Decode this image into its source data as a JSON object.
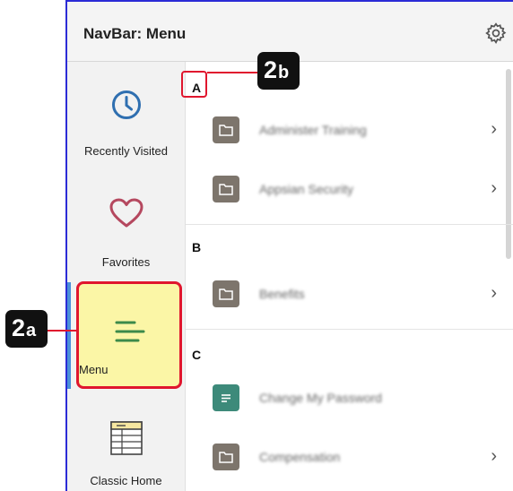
{
  "header": {
    "title": "NavBar: Menu",
    "settings_icon": "gear-icon"
  },
  "sidebar": {
    "items": [
      {
        "label": "Recently Visited",
        "icon": "clock-icon"
      },
      {
        "label": "Favorites",
        "icon": "heart-icon"
      },
      {
        "label": "Menu",
        "icon": "menu-lines-icon",
        "active": true
      },
      {
        "label": "Classic Home",
        "icon": "classic-home-icon"
      }
    ]
  },
  "menu": {
    "sections": [
      {
        "letter": "A",
        "items": [
          {
            "label": "Administer Training",
            "icon": "folder-icon",
            "has_children": true
          },
          {
            "label": "Appsian Security",
            "icon": "folder-icon",
            "has_children": true
          }
        ]
      },
      {
        "letter": "B",
        "items": [
          {
            "label": "Benefits",
            "icon": "folder-icon",
            "has_children": true
          }
        ]
      },
      {
        "letter": "C",
        "items": [
          {
            "label": "Change My Password",
            "icon": "page-icon",
            "has_children": false
          },
          {
            "label": "Compensation",
            "icon": "folder-icon",
            "has_children": true
          }
        ]
      }
    ]
  },
  "callouts": {
    "a": {
      "number": "2",
      "suffix": "a"
    },
    "b": {
      "number": "2",
      "suffix": "b"
    }
  },
  "colors": {
    "accent_border": "#2b2bd6",
    "highlight": "#e0162e",
    "active_bg": "#fbf6a6",
    "folder_icon": "#7d756c",
    "page_icon": "#3d8a7a",
    "clock": "#2f6fb0",
    "heart": "#b5485f",
    "menu_lines": "#3c8a4a"
  }
}
